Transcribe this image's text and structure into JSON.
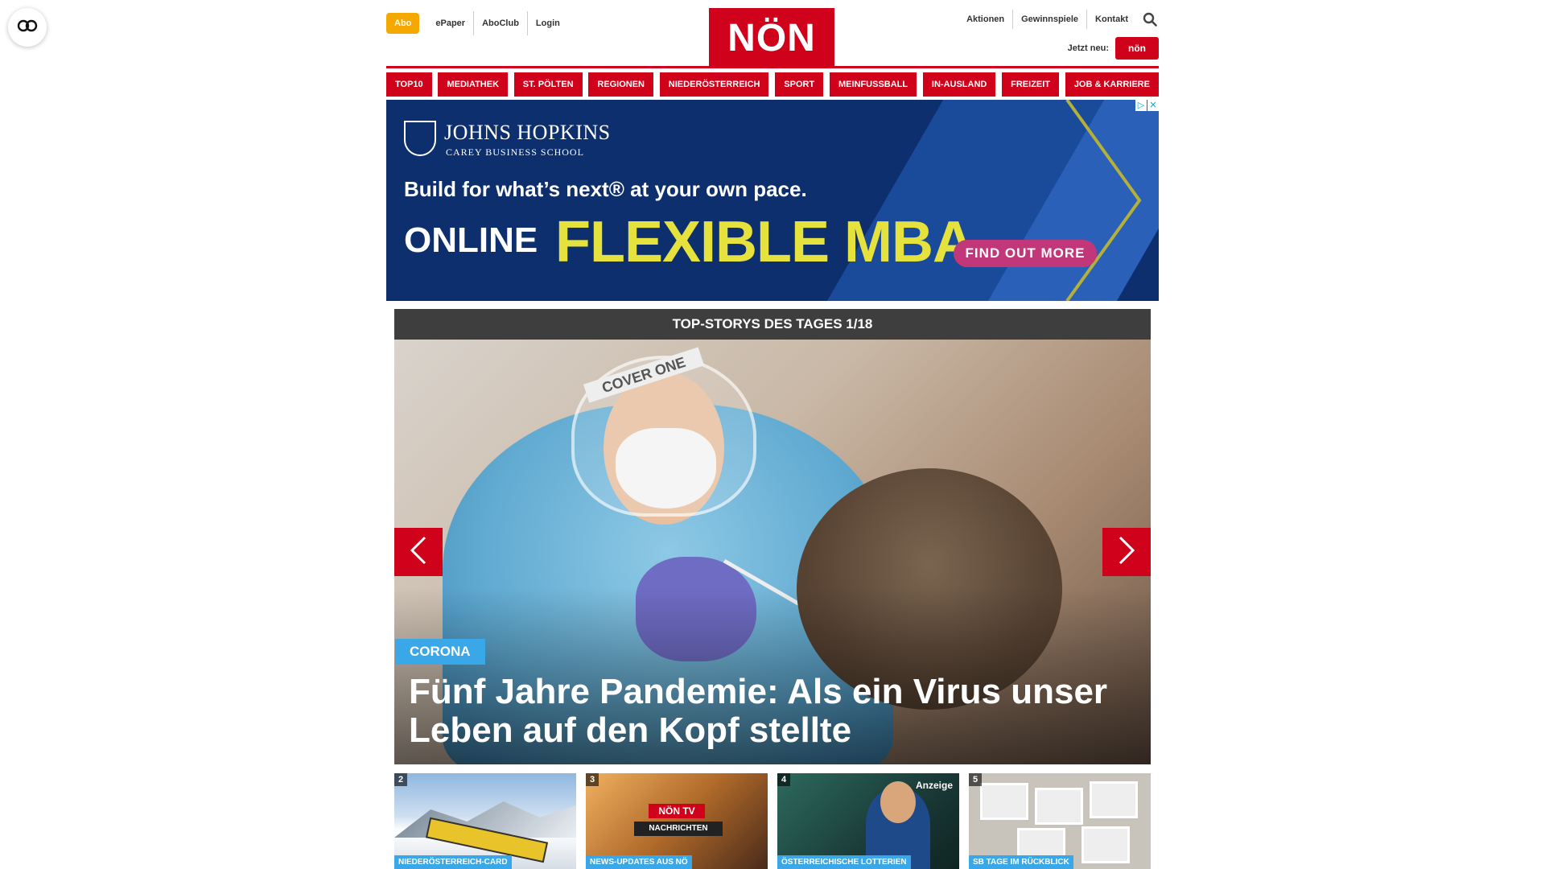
{
  "header": {
    "abo": "Abo",
    "links_left": [
      "ePaper",
      "AboClub",
      "Login"
    ],
    "logo": "NÖN",
    "links_right": [
      "Aktionen",
      "Gewinnspiele",
      "Kontakt"
    ],
    "jetzt_neu": "Jetzt neu:",
    "jetzt_logo": "nön"
  },
  "nav": [
    "TOP10",
    "MEDIATHEK",
    "ST. PÖLTEN",
    "REGIONEN",
    "NIEDERÖSTERREICH",
    "SPORT",
    "MEINFUSSBALL",
    "IN-AUSLAND",
    "FREIZEIT",
    "JOB & KARRIERE"
  ],
  "ad": {
    "brand": "JOHNS HOPKINS",
    "school": "CAREY BUSINESS SCHOOL",
    "headline": "Build for what’s next® at your own pace.",
    "online": "ONLINE",
    "program": "FLEXIBLE MBA",
    "cta": "FIND OUT MORE"
  },
  "top_stories": {
    "bar_title": "TOP-STORYS DES TAGES 1/18",
    "hero": {
      "category": "CORONA",
      "title": "Fünf Jahre Pandemie: Als ein Virus unser Leben auf den Kopf stellte",
      "visor_text": "COVER ONE"
    },
    "thumbs": [
      {
        "num": "2",
        "caption": "NIEDERÖSTERREICH-CARD"
      },
      {
        "num": "3",
        "caption": "NEWS-UPDATES AUS NÖ",
        "logo": "NÖN TV",
        "badge": "NACHRICHTEN"
      },
      {
        "num": "4",
        "caption": "ÖSTERREICHISCHE LOTTERIEN",
        "anzeige": "Anzeige"
      },
      {
        "num": "5",
        "caption": "SB TAGE IM RÜCKBLICK"
      }
    ]
  },
  "icons": {
    "accessibility": "accessibility-icon",
    "search": "search-icon",
    "prev": "chevron-left-icon",
    "next": "chevron-right-icon"
  },
  "colors": {
    "brand_red": "#d0021b",
    "abo_orange": "#f5a800",
    "category_blue": "#3aa8e8",
    "ad_navy": "#0d2f6e",
    "ad_yellow": "#e6e23d",
    "ad_cta": "#c2377a"
  }
}
